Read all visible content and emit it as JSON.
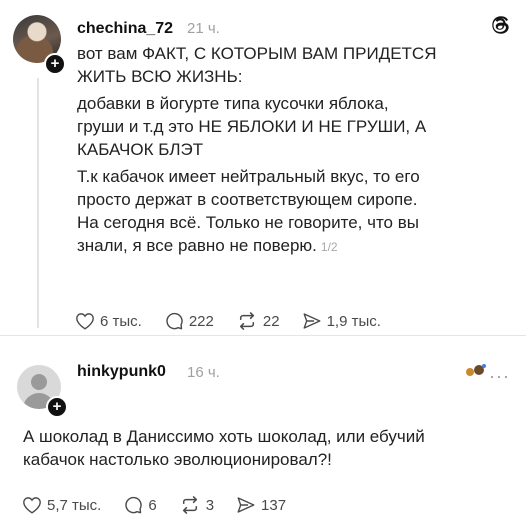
{
  "post1": {
    "username": "chechina_72",
    "time": "21 ч.",
    "lines": [
      "вот вам ФАКТ, С КОТОРЫМ ВАМ ПРИДЕТСЯ",
      "ЖИТЬ ВСЮ ЖИЗНЬ:",
      "добавки в йогурте типа кусочки яблока,",
      "груши и т.д это НЕ ЯБЛОКИ И НЕ ГРУШИ, А",
      "КАБАЧОК БЛЭТ",
      "Т.к кабачок имеет нейтральный вкус, то его",
      "просто держат в соответствующем сиропе.",
      "На сегодня всё. Только не говорите, что вы",
      "знали, я все равно не поверю."
    ],
    "pager": "1/2",
    "likes": "6 тыс.",
    "comments": "222",
    "reposts": "22",
    "shares": "1,9 тыс."
  },
  "post2": {
    "username": "hinkypunk0",
    "time": "16 ч.",
    "more": "···",
    "lines": [
      "А шоколад в Даниссимо хоть шоколад, или ебучий",
      "кабачок настолько эволюционировал?!"
    ],
    "likes": "5,7 тыс.",
    "comments": "6",
    "reposts": "3",
    "shares": "137"
  },
  "icons": [
    "threads-logo-icon",
    "heart-icon",
    "comment-icon",
    "repost-icon",
    "share-icon",
    "more-icon",
    "plus-icon"
  ]
}
